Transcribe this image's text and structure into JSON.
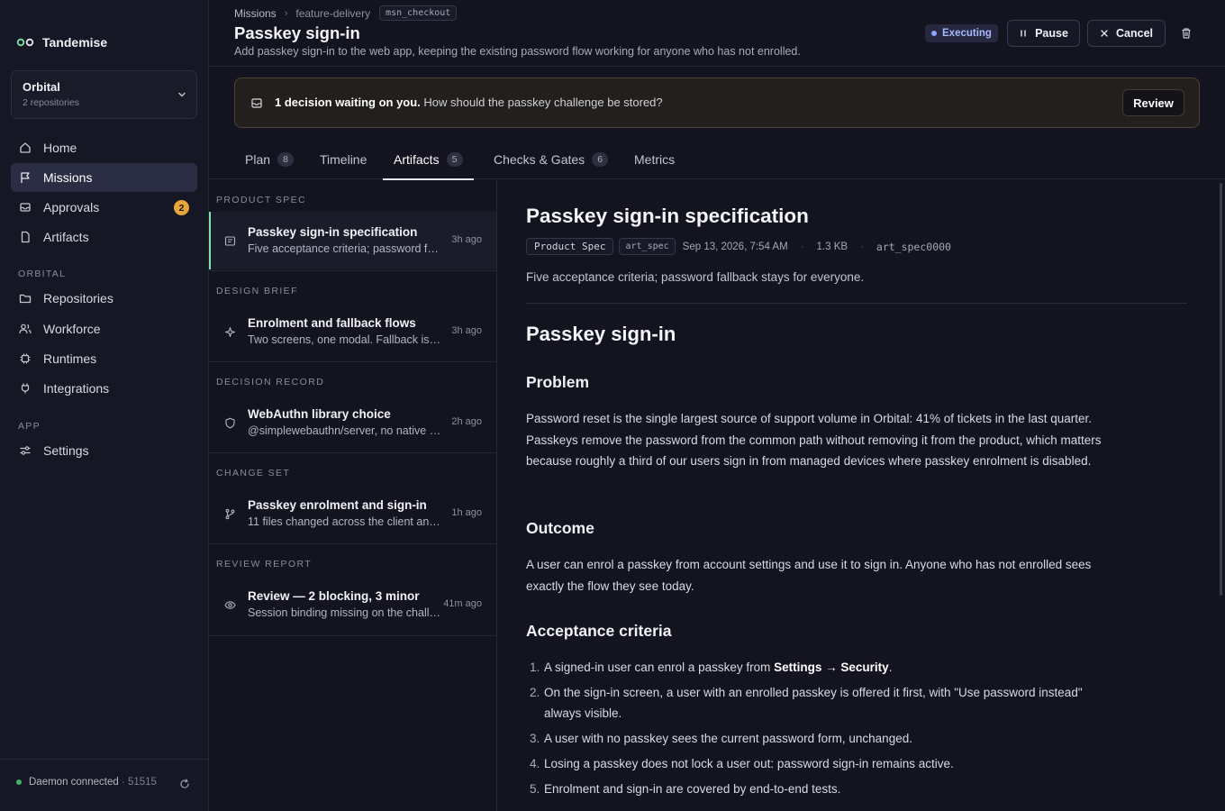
{
  "app": {
    "name": "Tandemise"
  },
  "workspace": {
    "name": "Orbital",
    "sub": "2 repositories"
  },
  "nav": {
    "home": "Home",
    "missions": "Missions",
    "approvals": "Approvals",
    "approvals_badge": "2",
    "artifacts": "Artifacts",
    "section_orbital": "ORBITAL",
    "repositories": "Repositories",
    "workforce": "Workforce",
    "runtimes": "Runtimes",
    "integrations": "Integrations",
    "section_app": "APP",
    "settings": "Settings"
  },
  "daemon": {
    "label": "Daemon connected",
    "port": "· 51515",
    "color": "#3fb26b"
  },
  "breadcrumb": {
    "root": "Missions",
    "parent": "feature-delivery",
    "id": "msn_checkout"
  },
  "mission": {
    "title": "Passkey sign-in",
    "description": "Add passkey sign-in to the web app, keeping the existing password flow working for anyone who has not enrolled.",
    "status": "Executing",
    "status_color": "#8ea2ff"
  },
  "actions": {
    "pause": "Pause",
    "cancel": "Cancel"
  },
  "decision": {
    "bold": "1 decision waiting on you.",
    "text": "How should the passkey challenge be stored?",
    "button": "Review"
  },
  "tabs": [
    {
      "label": "Plan",
      "count": "8"
    },
    {
      "label": "Timeline",
      "count": ""
    },
    {
      "label": "Artifacts",
      "count": "5"
    },
    {
      "label": "Checks & Gates",
      "count": "6"
    },
    {
      "label": "Metrics",
      "count": ""
    }
  ],
  "artifacts": [
    {
      "group": "PRODUCT SPEC",
      "title": "Passkey sign-in specification",
      "summary": "Five acceptance criteria; password fallback stays for everyone.",
      "time": "3h ago",
      "icon": "doc-icon"
    },
    {
      "group": "DESIGN BRIEF",
      "title": "Enrolment and fallback flows",
      "summary": "Two screens, one modal. Fallback is always visible.",
      "time": "3h ago",
      "icon": "sparkle-icon"
    },
    {
      "group": "DECISION RECORD",
      "title": "WebAuthn library choice",
      "summary": "@simplewebauthn/server, no native bindings.",
      "time": "2h ago",
      "icon": "shield-icon"
    },
    {
      "group": "CHANGE SET",
      "title": "Passkey enrolment and sign-in",
      "summary": "11 files changed across the client and server.",
      "time": "1h ago",
      "icon": "branch-icon"
    },
    {
      "group": "REVIEW REPORT",
      "title": "Review — 2 blocking, 3 minor",
      "summary": "Session binding missing on the challenge store.",
      "time": "41m ago",
      "icon": "eye-icon"
    }
  ],
  "doc": {
    "title": "Passkey sign-in specification",
    "type_chip": "Product Spec",
    "kind_chip": "art_spec",
    "date": "Sep 13, 2026, 7:54 AM",
    "dot": "·",
    "size": "1.3 KB",
    "id": "art_spec0000",
    "summary": "Five acceptance criteria; password fallback stays for everyone.",
    "h1": "Passkey sign-in",
    "problem_heading": "Problem",
    "problem_text": "Password reset is the single largest source of support volume in Orbital: 41% of tickets in the last quarter. Passkeys remove the password from the common path without removing it from the product, which matters because roughly a third of our users sign in from managed devices where passkey enrolment is disabled.",
    "outcome_heading": "Outcome",
    "outcome_text": "A user can enrol a passkey from account settings and use it to sign in. Anyone who has not enrolled sees exactly the flow they see today.",
    "criteria_heading": "Acceptance criteria",
    "criteria": [
      {
        "num": "1.",
        "pre": "A signed-in user can enrol a passkey from ",
        "bold": "Settings → Security",
        "post": "."
      },
      {
        "num": "2.",
        "pre": "On the sign-in screen, a user with an enrolled passkey is offered it first, with \"Use password instead\" always visible.",
        "bold": "",
        "post": ""
      },
      {
        "num": "3.",
        "pre": "A user with no passkey sees the current password form, unchanged.",
        "bold": "",
        "post": ""
      },
      {
        "num": "4.",
        "pre": "Losing a passkey does not lock a user out: password sign-in remains active.",
        "bold": "",
        "post": ""
      },
      {
        "num": "5.",
        "pre": "Enrolment and sign-in are covered by end-to-end tests.",
        "bold": "",
        "post": ""
      }
    ]
  }
}
